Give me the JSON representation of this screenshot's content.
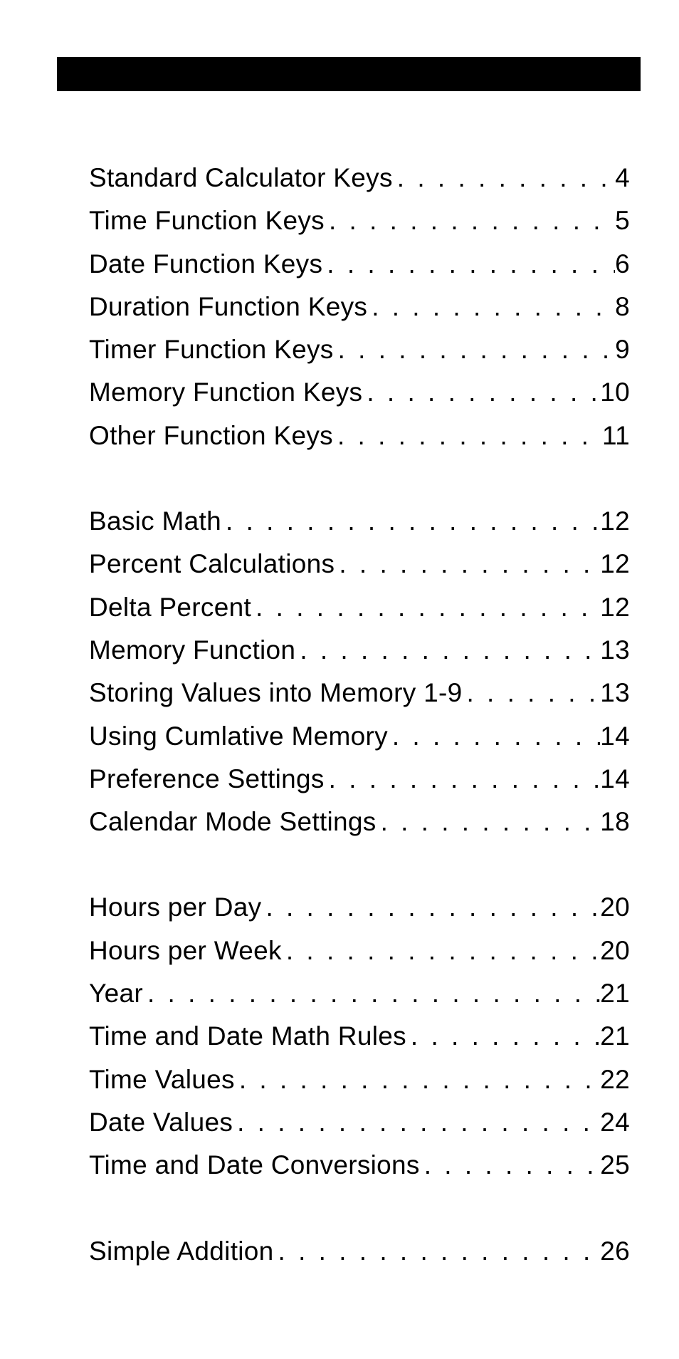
{
  "sections": [
    {
      "entries": [
        {
          "title": "Standard Calculator Keys",
          "page": "4"
        },
        {
          "title": "Time Function Keys",
          "page": "5"
        },
        {
          "title": "Date Function Keys",
          "page": "6"
        },
        {
          "title": "Duration Function Keys",
          "page": "8"
        },
        {
          "title": "Timer Function Keys",
          "page": "9"
        },
        {
          "title": "Memory Function Keys",
          "page": "10"
        },
        {
          "title": "Other Function Keys",
          "page": "11"
        }
      ]
    },
    {
      "entries": [
        {
          "title": "Basic Math",
          "page": "12"
        },
        {
          "title": "Percent Calculations",
          "page": "12"
        },
        {
          "title": "Delta Percent",
          "page": "12"
        },
        {
          "title": "Memory Function",
          "page": "13"
        },
        {
          "title": "Storing Values into Memory 1-9",
          "page": "13"
        },
        {
          "title": "Using Cumlative Memory",
          "page": "14"
        },
        {
          "title": "Preference Settings",
          "page": "14"
        },
        {
          "title": "Calendar Mode Settings",
          "page": "18"
        }
      ]
    },
    {
      "entries": [
        {
          "title": "Hours per Day",
          "page": "20"
        },
        {
          "title": "Hours per Week",
          "page": "20"
        },
        {
          "title": "Year",
          "page": "21"
        },
        {
          "title": "Time and Date Math Rules",
          "page": "21"
        },
        {
          "title": "Time Values",
          "page": "22"
        },
        {
          "title": "Date Values",
          "page": "24"
        },
        {
          "title": "Time and Date Conversions",
          "page": "25"
        }
      ]
    },
    {
      "entries": [
        {
          "title": "Simple Addition",
          "page": "26"
        }
      ]
    }
  ]
}
